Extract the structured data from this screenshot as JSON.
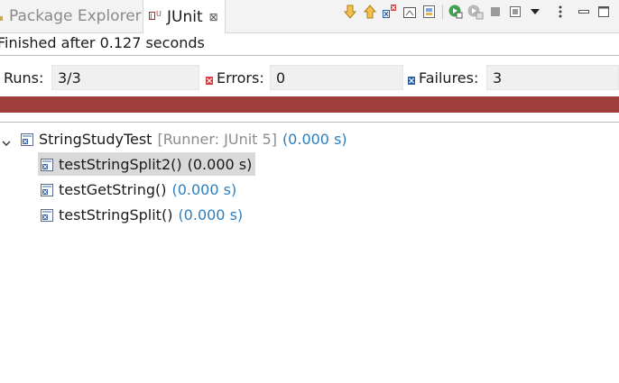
{
  "tabs": {
    "package_explorer": "Package Explorer",
    "junit": "JUnit",
    "close_glyph": "⊠"
  },
  "toolbar": {
    "icons": [
      "next-failure-icon",
      "previous-failure-icon",
      "show-failures-only-icon",
      "scroll-lock-icon",
      "show-skipped-icon",
      "rerun-test-icon",
      "rerun-failed-first-icon",
      "stop-icon",
      "history-dropdown-icon",
      "view-menu-icon",
      "minimize-icon",
      "maximize-icon"
    ]
  },
  "status": "Finished after 0.127 seconds",
  "counters": {
    "runs_label": "Runs:",
    "runs_value": "3/3",
    "errors_label": "Errors:",
    "errors_value": "0",
    "failures_label": "Failures:",
    "failures_value": "3"
  },
  "progress": {
    "state": "failed",
    "color": "#a13e3e",
    "fraction": 1.0
  },
  "tree": {
    "suite": {
      "name": "StringStudyTest",
      "runner": "[Runner: JUnit 5]",
      "time": "(0.000 s)"
    },
    "tests": [
      {
        "name": "testStringSplit2()",
        "time": "(0.000 s)",
        "selected": true
      },
      {
        "name": "testGetString()",
        "time": "(0.000 s)",
        "selected": false
      },
      {
        "name": "testStringSplit()",
        "time": "(0.000 s)",
        "selected": false
      }
    ]
  },
  "colors": {
    "time": "#2b7fc0",
    "meta": "#8c8c8c",
    "error_icon": "#d63b3b",
    "failure_icon": "#2f5fa3"
  }
}
